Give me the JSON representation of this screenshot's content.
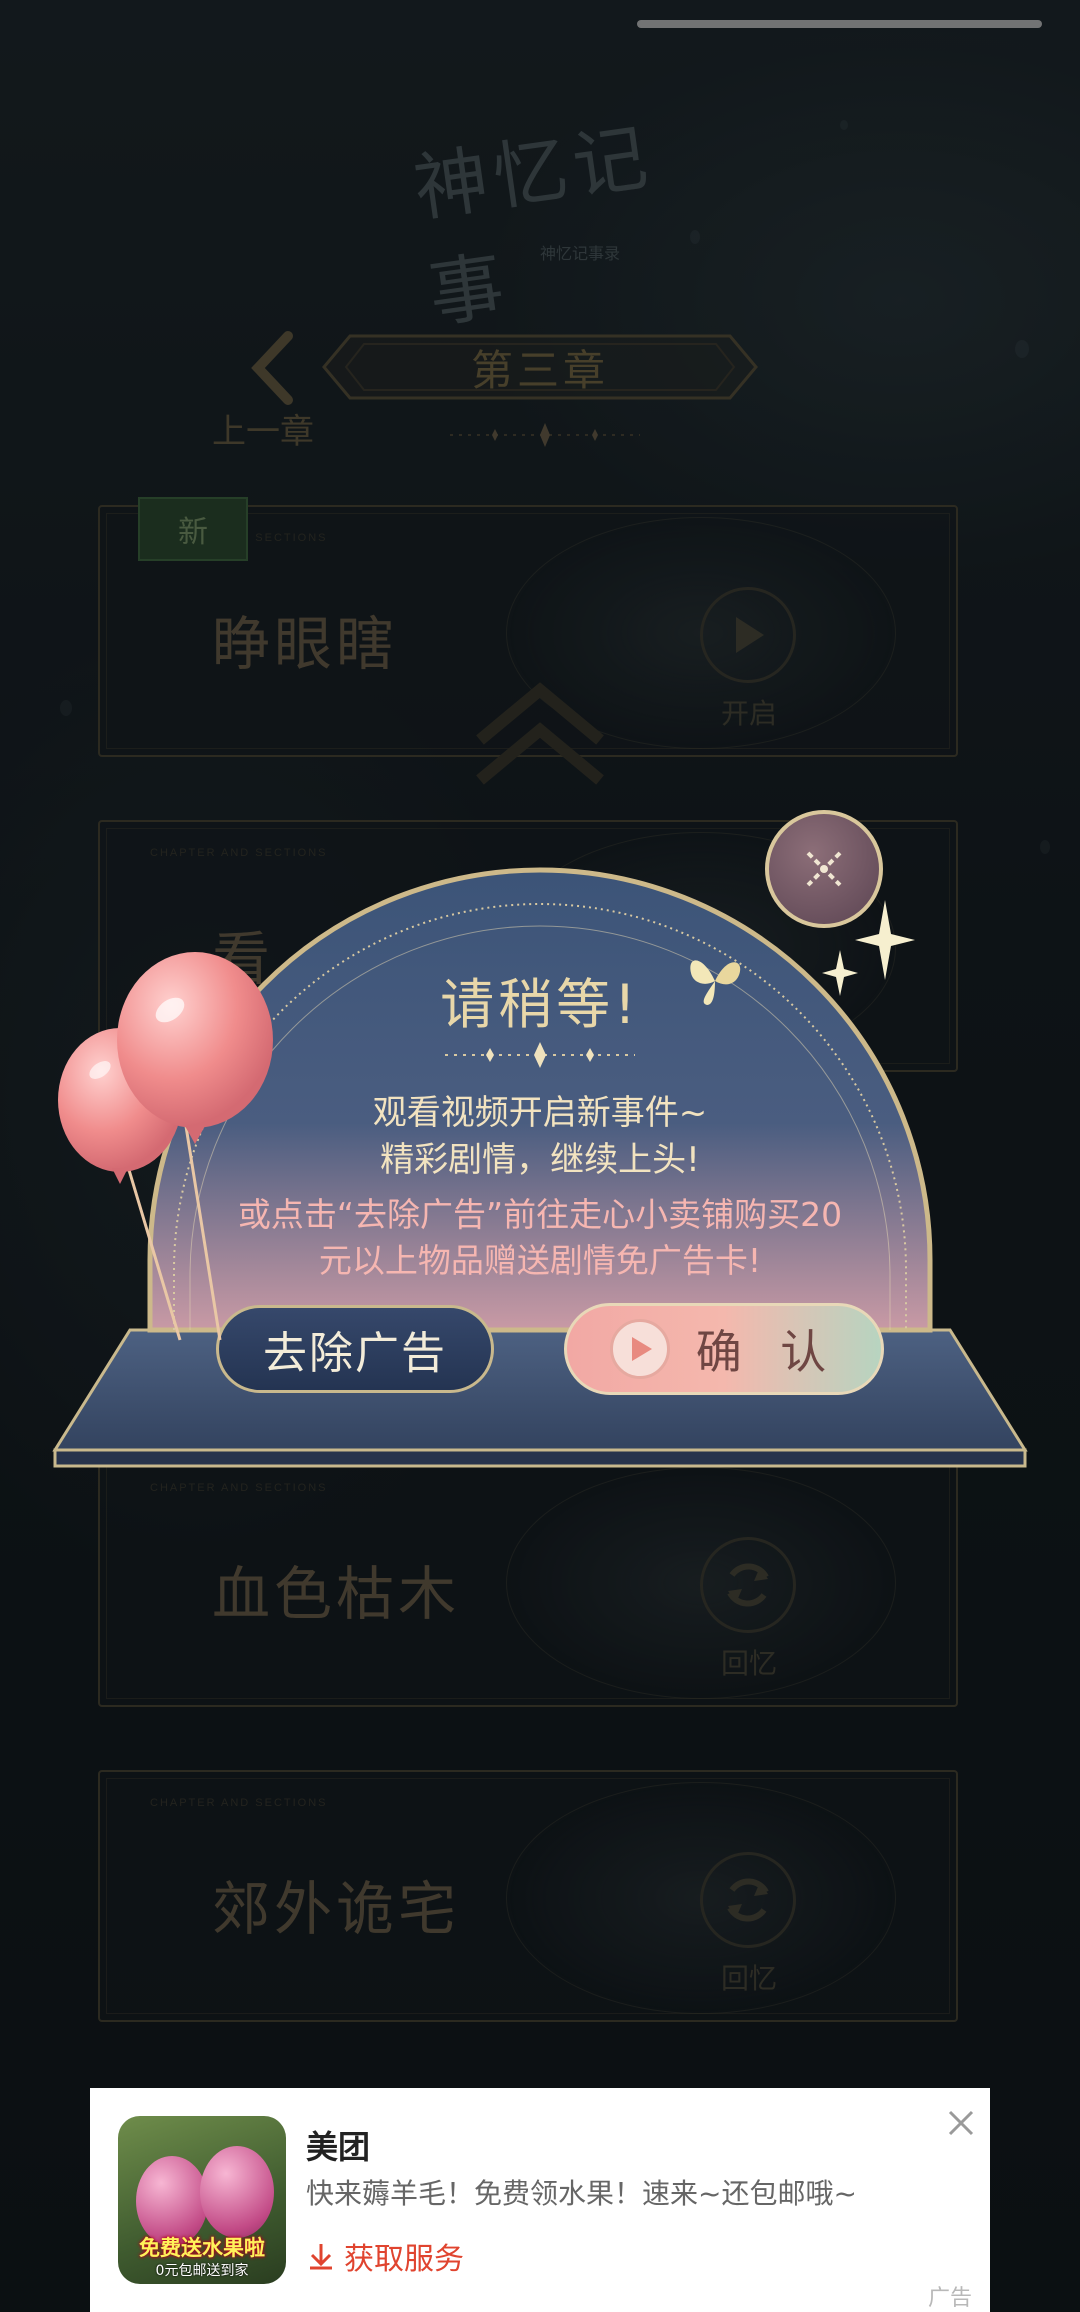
{
  "header": {
    "logo_text": "神忆记事",
    "logo_subtitle": "神忆记事录",
    "chapter_title": "第三章",
    "prev_chapter_label": "上一章"
  },
  "chapters": [
    {
      "name": "睁眼瞎",
      "action": "开启",
      "badge": "新",
      "caption": "CHAPTER AND SECTIONS"
    },
    {
      "name": "看",
      "action": "",
      "badge": "",
      "caption": "CHAPTER AND SECTIONS"
    },
    {
      "name": "血色枯木",
      "action": "回忆",
      "badge": "",
      "caption": "CHAPTER AND SECTIONS"
    },
    {
      "name": "郊外诡宅",
      "action": "回忆",
      "badge": "",
      "caption": "CHAPTER AND SECTIONS"
    }
  ],
  "dialog": {
    "title": "请稍等!",
    "line1": "观看视频开启新事件~",
    "line2": "精彩剧情，继续上头!",
    "line3": "或点击“去除广告”前往走心小卖铺购买20",
    "line4": "元以上物品赠送剧情免广告卡!",
    "remove_ads_label": "去除广告",
    "confirm_label": "确 认"
  },
  "ad": {
    "brand": "美团",
    "description": "快来薅羊毛！免费领水果！速来~还包邮哦~",
    "cta": "获取服务",
    "thumb_title": "免费送水果啦",
    "thumb_subtitle": "0元包邮送到家",
    "label": "广告"
  },
  "colors": {
    "background": "#121a1e",
    "gold": "#a8966a",
    "dialog_blue": "#3a4d6e",
    "confirm_pink": "#f2a8a4",
    "ad_cta": "#e0442f"
  },
  "icons": {
    "prev": "chevron-left-icon",
    "play": "play-icon",
    "replay": "refresh-icon",
    "close": "close-icon",
    "download": "download-icon"
  }
}
